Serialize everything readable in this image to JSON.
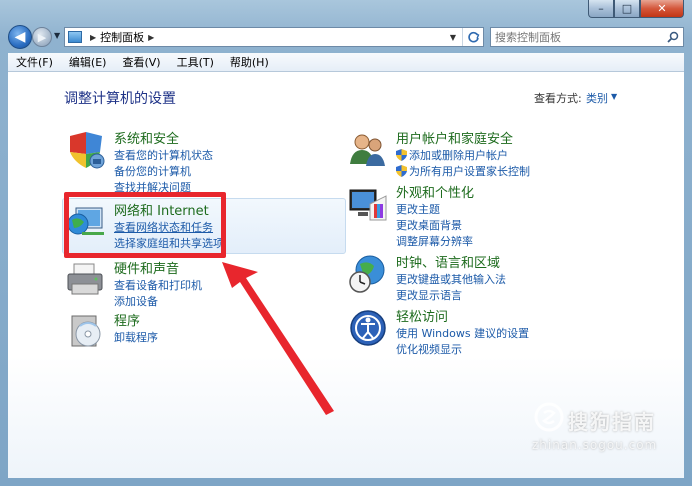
{
  "window": {
    "controls": {
      "minimize": "–",
      "maximize": "□",
      "close": "✕"
    }
  },
  "nav": {
    "back_glyph": "◀",
    "forward_glyph": "▶",
    "breadcrumb": [
      "控制面板"
    ],
    "search_placeholder": "搜索控制面板"
  },
  "menu": [
    "文件(F)",
    "编辑(E)",
    "查看(V)",
    "工具(T)",
    "帮助(H)"
  ],
  "content": {
    "title": "调整计算机的设置",
    "view_by_label": "查看方式:",
    "view_by_value": "类别"
  },
  "categories": [
    {
      "title": "系统和安全",
      "links": [
        "查看您的计算机状态",
        "备份您的计算机",
        "查找并解决问题"
      ]
    },
    {
      "title": "网络和 Internet",
      "links": [
        "查看网络状态和任务",
        "选择家庭组和共享选项"
      ]
    },
    {
      "title": "硬件和声音",
      "links": [
        "查看设备和打印机",
        "添加设备"
      ]
    },
    {
      "title": "程序",
      "links": [
        "卸载程序"
      ]
    },
    {
      "title": "用户帐户和家庭安全",
      "links": [
        "添加或删除用户帐户",
        "为所有用户设置家长控制"
      ]
    },
    {
      "title": "外观和个性化",
      "links": [
        "更改主题",
        "更改桌面背景",
        "调整屏幕分辨率"
      ]
    },
    {
      "title": "时钟、语言和区域",
      "links": [
        "更改键盘或其他输入法",
        "更改显示语言"
      ]
    },
    {
      "title": "轻松访问",
      "links": [
        "使用 Windows 建议的设置",
        "优化视频显示"
      ]
    }
  ],
  "watermark": {
    "text": "搜狗指南",
    "url": "zhinan.sogou.com"
  },
  "colors": {
    "highlight": "#e8262d",
    "link": "#1c5aa8",
    "category_title": "#1d6b1d",
    "page_title": "#1e3287"
  }
}
